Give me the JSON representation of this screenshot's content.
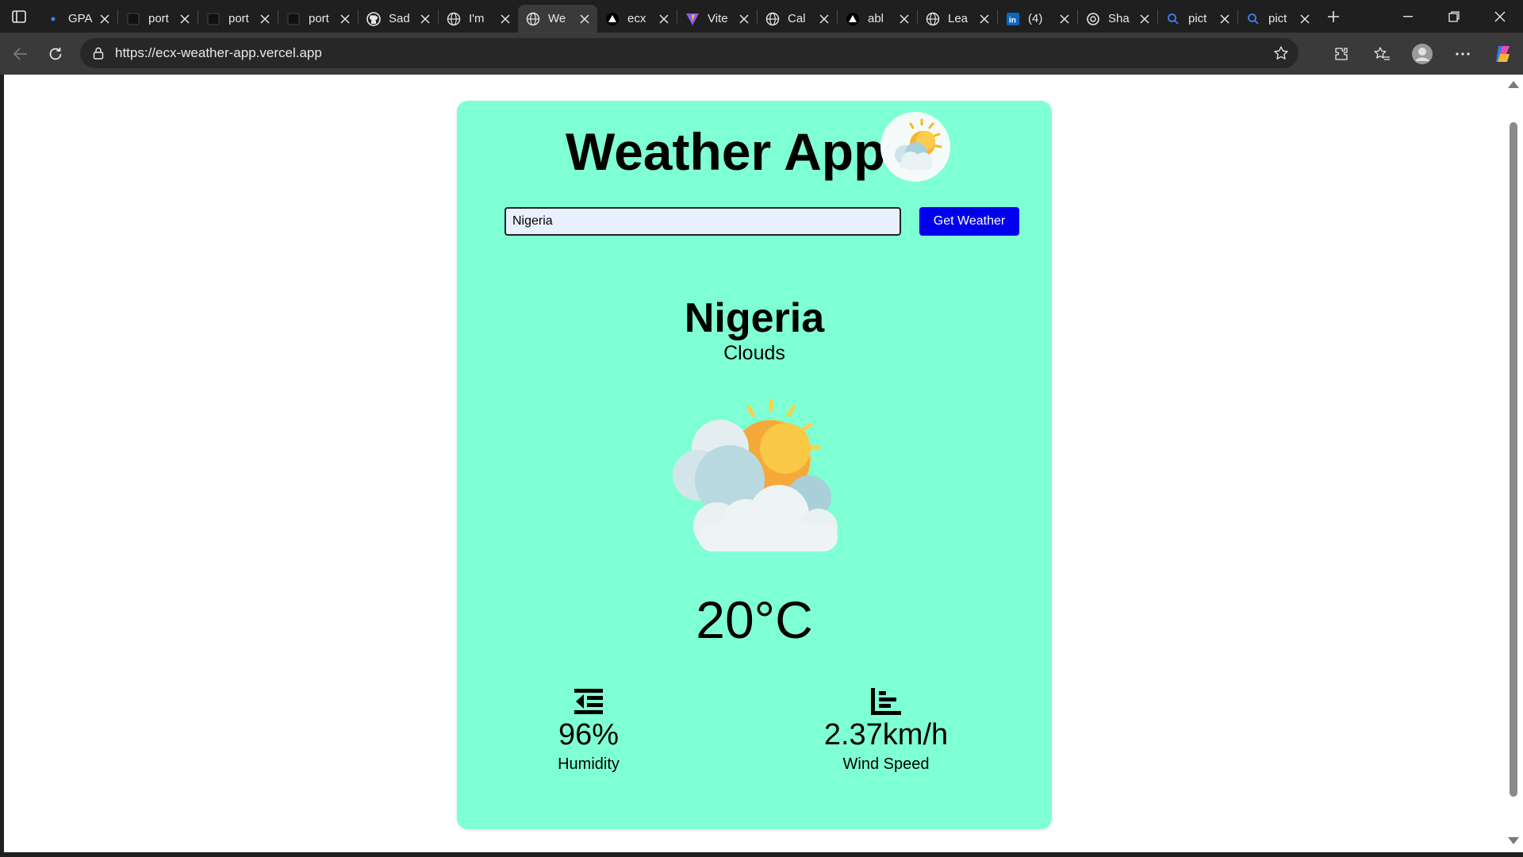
{
  "browser": {
    "tabs": [
      {
        "title": "GPA",
        "icon": "dot-icon"
      },
      {
        "title": "port",
        "icon": "page-icon"
      },
      {
        "title": "port",
        "icon": "page-icon"
      },
      {
        "title": "port",
        "icon": "page-icon"
      },
      {
        "title": "Sad",
        "icon": "github-icon"
      },
      {
        "title": "I'm",
        "icon": "globe-icon"
      },
      {
        "title": "We",
        "icon": "globe-icon",
        "active": true
      },
      {
        "title": "ecx",
        "icon": "vercel-icon"
      },
      {
        "title": "Vite",
        "icon": "vite-icon"
      },
      {
        "title": "Cal",
        "icon": "globe-icon"
      },
      {
        "title": "abl",
        "icon": "vercel-icon"
      },
      {
        "title": "Lea",
        "icon": "globe-icon"
      },
      {
        "title": "(4)",
        "icon": "linkedin-icon"
      },
      {
        "title": "Sha",
        "icon": "openai-icon"
      },
      {
        "title": "pict",
        "icon": "search-icon"
      },
      {
        "title": "pict",
        "icon": "search-icon"
      }
    ],
    "url": "https://ecx-weather-app.vercel.app"
  },
  "app": {
    "title": "Weather App",
    "search": {
      "value": "Nigeria",
      "button_label": "Get Weather"
    },
    "weather": {
      "city": "Nigeria",
      "condition": "Clouds",
      "temperature": "20°C",
      "humidity": {
        "value": "96%",
        "label": "Humidity"
      },
      "wind": {
        "value": "2.37km/h",
        "label": "Wind Speed"
      }
    }
  },
  "colors": {
    "card_bg": "#7fffd4",
    "button_bg": "#0000ee",
    "input_bg": "#e8f0fe"
  }
}
